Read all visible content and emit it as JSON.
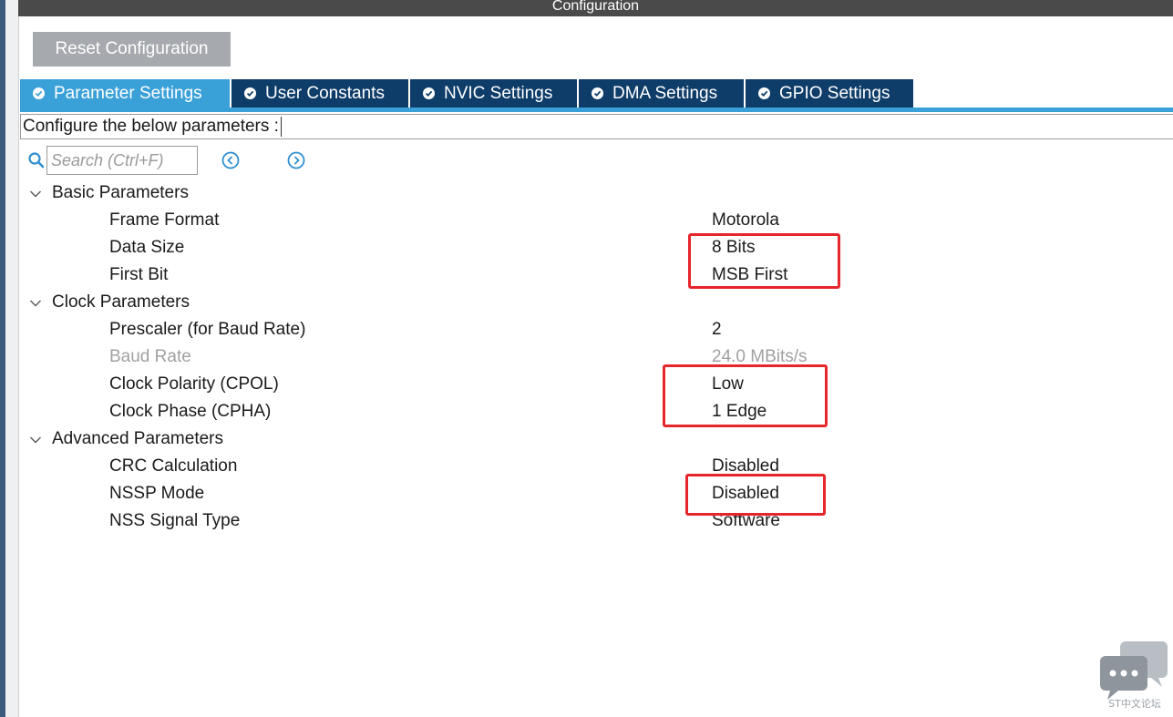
{
  "window": {
    "title": "Configuration"
  },
  "toolbar": {
    "reset_label": "Reset Configuration"
  },
  "tabs": [
    {
      "label": "Parameter Settings",
      "active": true
    },
    {
      "label": "User Constants",
      "active": false
    },
    {
      "label": "NVIC Settings",
      "active": false
    },
    {
      "label": "DMA Settings",
      "active": false
    },
    {
      "label": "GPIO Settings",
      "active": false
    }
  ],
  "hint": "Configure the below parameters :",
  "search": {
    "placeholder": "Search (Ctrl+F)",
    "value": ""
  },
  "groups": [
    {
      "label": "Basic Parameters",
      "params": [
        {
          "label": "Frame Format",
          "value": "Motorola"
        },
        {
          "label": "Data Size",
          "value": "8 Bits"
        },
        {
          "label": "First Bit",
          "value": "MSB First"
        }
      ]
    },
    {
      "label": "Clock Parameters",
      "params": [
        {
          "label": "Prescaler (for Baud Rate)",
          "value": "2"
        },
        {
          "label": "Baud Rate",
          "value": "24.0 MBits/s"
        },
        {
          "label": "Clock Polarity (CPOL)",
          "value": "Low"
        },
        {
          "label": "Clock Phase (CPHA)",
          "value": "1 Edge"
        }
      ]
    },
    {
      "label": "Advanced Parameters",
      "params": [
        {
          "label": "CRC Calculation",
          "value": "Disabled"
        },
        {
          "label": "NSSP Mode",
          "value": "Disabled"
        },
        {
          "label": "NSS Signal Type",
          "value": "Software"
        }
      ]
    }
  ],
  "watermark": {
    "text": "ST中文论坛"
  },
  "colors": {
    "active_tab": "#3aa0d8",
    "inactive_tab": "#0f3d69",
    "highlight": "#e5262a",
    "reset_button": "#a6a9ad"
  }
}
